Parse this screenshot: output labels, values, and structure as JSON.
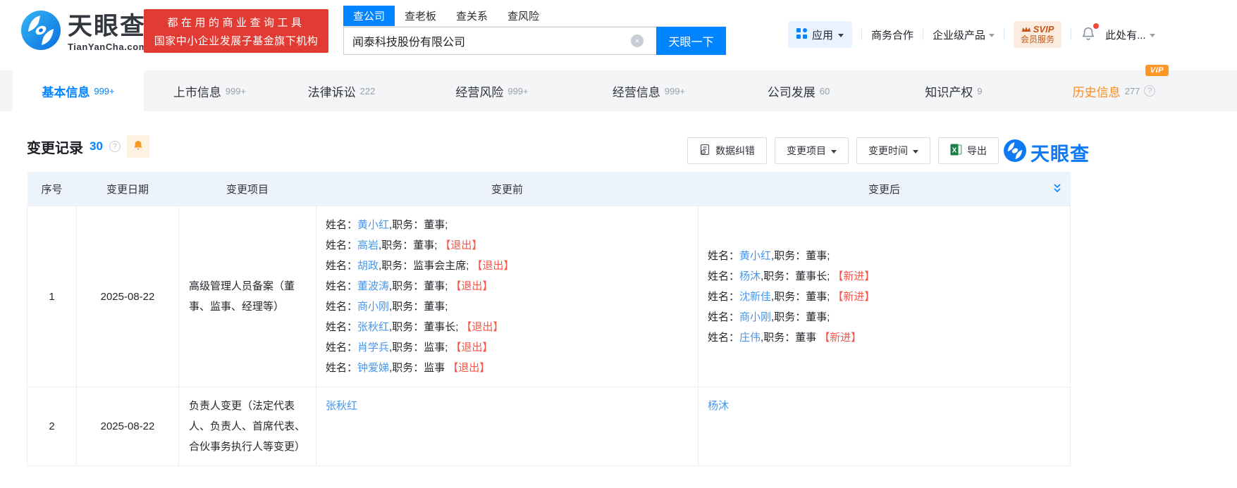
{
  "brand": {
    "name_cn": "天眼查",
    "name_en": "TianYanCha.com"
  },
  "banner": {
    "line1": "都在用的商业查询工具",
    "line2": "国家中小企业发展子基金旗下机构"
  },
  "search": {
    "tabs": [
      {
        "label": "查公司",
        "active": true
      },
      {
        "label": "查老板",
        "active": false
      },
      {
        "label": "查关系",
        "active": false
      },
      {
        "label": "查风险",
        "active": false
      }
    ],
    "value": "闻泰科技股份有限公司",
    "button": "天眼一下"
  },
  "nav": {
    "apps": "应用",
    "links": [
      "商务合作",
      "企业级产品"
    ],
    "svip_line1": "SVIP",
    "svip_line2": "会员服务",
    "user": "此处有..."
  },
  "vip_label": "VIP",
  "icons": {
    "help": "?",
    "clear": "×"
  },
  "tabs": [
    {
      "label": "基本信息",
      "count": "999+",
      "active": true
    },
    {
      "label": "上市信息",
      "count": "999+"
    },
    {
      "label": "法律诉讼",
      "count": "222"
    },
    {
      "label": "经营风险",
      "count": "999+"
    },
    {
      "label": "经营信息",
      "count": "999+"
    },
    {
      "label": "公司发展",
      "count": "60"
    },
    {
      "label": "知识产权",
      "count": "9"
    },
    {
      "label": "历史信息",
      "count": "277",
      "vip": true,
      "help": true,
      "orange": true
    }
  ],
  "section": {
    "title": "变更记录",
    "count": "30",
    "buttons": [
      {
        "label": "数据纠错",
        "icon": "doc-correct"
      },
      {
        "label": "变更项目",
        "dropdown": true
      },
      {
        "label": "变更时间",
        "dropdown": true
      },
      {
        "label": "导出",
        "icon": "excel"
      }
    ],
    "watermark": "天眼查"
  },
  "table": {
    "headers": [
      "序号",
      "变更日期",
      "变更项目",
      "变更前",
      "变更后"
    ],
    "rows": [
      {
        "no": "1",
        "date": "2025-08-22",
        "item": "高级管理人员备案（董事、监事、经理等）",
        "before": [
          [
            {
              "t": "姓名：",
              "c": "p"
            },
            {
              "t": "黄小红",
              "c": "link"
            },
            {
              "t": ",职务：董事;",
              "c": "p"
            }
          ],
          [
            {
              "t": "姓名：",
              "c": "p"
            },
            {
              "t": "高岩",
              "c": "link"
            },
            {
              "t": ",职务：董事;",
              "c": "p"
            },
            {
              "t": "【退出】",
              "c": "tag"
            }
          ],
          [
            {
              "t": "姓名：",
              "c": "p"
            },
            {
              "t": "胡政",
              "c": "link"
            },
            {
              "t": ",职务：监事会主席;",
              "c": "p"
            },
            {
              "t": "【退出】",
              "c": "tag"
            }
          ],
          [
            {
              "t": "姓名：",
              "c": "p"
            },
            {
              "t": "董波涛",
              "c": "link"
            },
            {
              "t": ",职务：董事;",
              "c": "p"
            },
            {
              "t": "【退出】",
              "c": "tag"
            }
          ],
          [
            {
              "t": "姓名：",
              "c": "p"
            },
            {
              "t": "商小刚",
              "c": "link"
            },
            {
              "t": ",职务：董事;",
              "c": "p"
            }
          ],
          [
            {
              "t": "姓名：",
              "c": "p"
            },
            {
              "t": "张秋红",
              "c": "link"
            },
            {
              "t": ",职务：董事长;",
              "c": "p"
            },
            {
              "t": "【退出】",
              "c": "tag"
            }
          ],
          [
            {
              "t": "姓名：",
              "c": "p"
            },
            {
              "t": "肖学兵",
              "c": "link"
            },
            {
              "t": ",职务：监事;",
              "c": "p"
            },
            {
              "t": "【退出】",
              "c": "tag"
            }
          ],
          [
            {
              "t": "姓名：",
              "c": "p"
            },
            {
              "t": "钟爱娣",
              "c": "link"
            },
            {
              "t": ",职务：监事",
              "c": "p"
            },
            {
              "t": "【退出】",
              "c": "tag"
            }
          ]
        ],
        "after": [
          [
            {
              "t": "姓名：",
              "c": "p"
            },
            {
              "t": "黄小红",
              "c": "link"
            },
            {
              "t": ",职务：董事;",
              "c": "p"
            }
          ],
          [
            {
              "t": "姓名：",
              "c": "p"
            },
            {
              "t": "杨沐",
              "c": "link"
            },
            {
              "t": ",职务：董事长;",
              "c": "p"
            },
            {
              "t": "【新进】",
              "c": "tag"
            }
          ],
          [
            {
              "t": "姓名：",
              "c": "p"
            },
            {
              "t": "沈新佳",
              "c": "link"
            },
            {
              "t": ",职务：董事;",
              "c": "p"
            },
            {
              "t": "【新进】",
              "c": "tag"
            }
          ],
          [
            {
              "t": "姓名：",
              "c": "p"
            },
            {
              "t": "商小刚",
              "c": "link"
            },
            {
              "t": ",职务：董事;",
              "c": "p"
            }
          ],
          [
            {
              "t": "姓名：",
              "c": "p"
            },
            {
              "t": "庄伟",
              "c": "link"
            },
            {
              "t": ",职务：董事",
              "c": "p"
            },
            {
              "t": "【新进】",
              "c": "tag"
            }
          ]
        ]
      },
      {
        "no": "2",
        "date": "2025-08-22",
        "item": "负责人变更（法定代表人、负责人、首席代表、合伙事务执行人等变更）",
        "before": [
          [
            {
              "t": "张秋红",
              "c": "link"
            }
          ]
        ],
        "after": [
          [
            {
              "t": "杨沐",
              "c": "link"
            }
          ]
        ]
      }
    ]
  },
  "colors": {
    "accent": "#0084ff",
    "link": "#4696ec",
    "tag_red": "#f5564a",
    "banner_red": "#e23b33",
    "history_orange": "#ff8a1e"
  }
}
